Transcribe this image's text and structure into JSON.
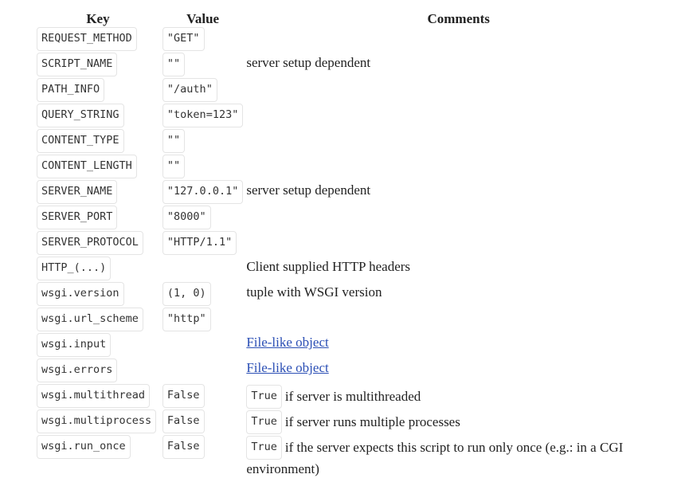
{
  "table": {
    "headers": {
      "key": "Key",
      "value": "Value",
      "comments": "Comments"
    },
    "rows": [
      {
        "key": "REQUEST_METHOD",
        "value": "\"GET\"",
        "comment": "",
        "comment_code": "",
        "link": false
      },
      {
        "key": "SCRIPT_NAME",
        "value": "\"\"",
        "comment": "server setup dependent",
        "comment_code": "",
        "link": false
      },
      {
        "key": "PATH_INFO",
        "value": "\"/auth\"",
        "comment": "",
        "comment_code": "",
        "link": false
      },
      {
        "key": "QUERY_STRING",
        "value": "\"token=123\"",
        "comment": "",
        "comment_code": "",
        "link": false
      },
      {
        "key": "CONTENT_TYPE",
        "value": "\"\"",
        "comment": "",
        "comment_code": "",
        "link": false
      },
      {
        "key": "CONTENT_LENGTH",
        "value": "\"\"",
        "comment": "",
        "comment_code": "",
        "link": false
      },
      {
        "key": "SERVER_NAME",
        "value": "\"127.0.0.1\"",
        "comment": "server setup dependent",
        "comment_code": "",
        "link": false
      },
      {
        "key": "SERVER_PORT",
        "value": "\"8000\"",
        "comment": "",
        "comment_code": "",
        "link": false
      },
      {
        "key": "SERVER_PROTOCOL",
        "value": "\"HTTP/1.1\"",
        "comment": "",
        "comment_code": "",
        "link": false
      },
      {
        "key": "HTTP_(...)",
        "value": "",
        "comment": "Client supplied HTTP headers",
        "comment_code": "",
        "link": false
      },
      {
        "key": "wsgi.version",
        "value": "(1, 0)",
        "comment": "tuple with WSGI version",
        "comment_code": "",
        "link": false
      },
      {
        "key": "wsgi.url_scheme",
        "value": "\"http\"",
        "comment": "",
        "comment_code": "",
        "link": false
      },
      {
        "key": "wsgi.input",
        "value": "",
        "comment": "File-like object",
        "comment_code": "",
        "link": true
      },
      {
        "key": "wsgi.errors",
        "value": "",
        "comment": "File-like object",
        "comment_code": "",
        "link": true
      },
      {
        "key": "wsgi.multithread",
        "value": "False",
        "comment": "if server is multithreaded",
        "comment_code": "True",
        "link": false
      },
      {
        "key": "wsgi.multiprocess",
        "value": "False",
        "comment": "if server runs multiple processes",
        "comment_code": "True",
        "link": false
      },
      {
        "key": "wsgi.run_once",
        "value": "False",
        "comment": "if the server expects this script to run only once (e.g.: in a CGI environment)",
        "comment_code": "True",
        "link": false
      }
    ]
  }
}
